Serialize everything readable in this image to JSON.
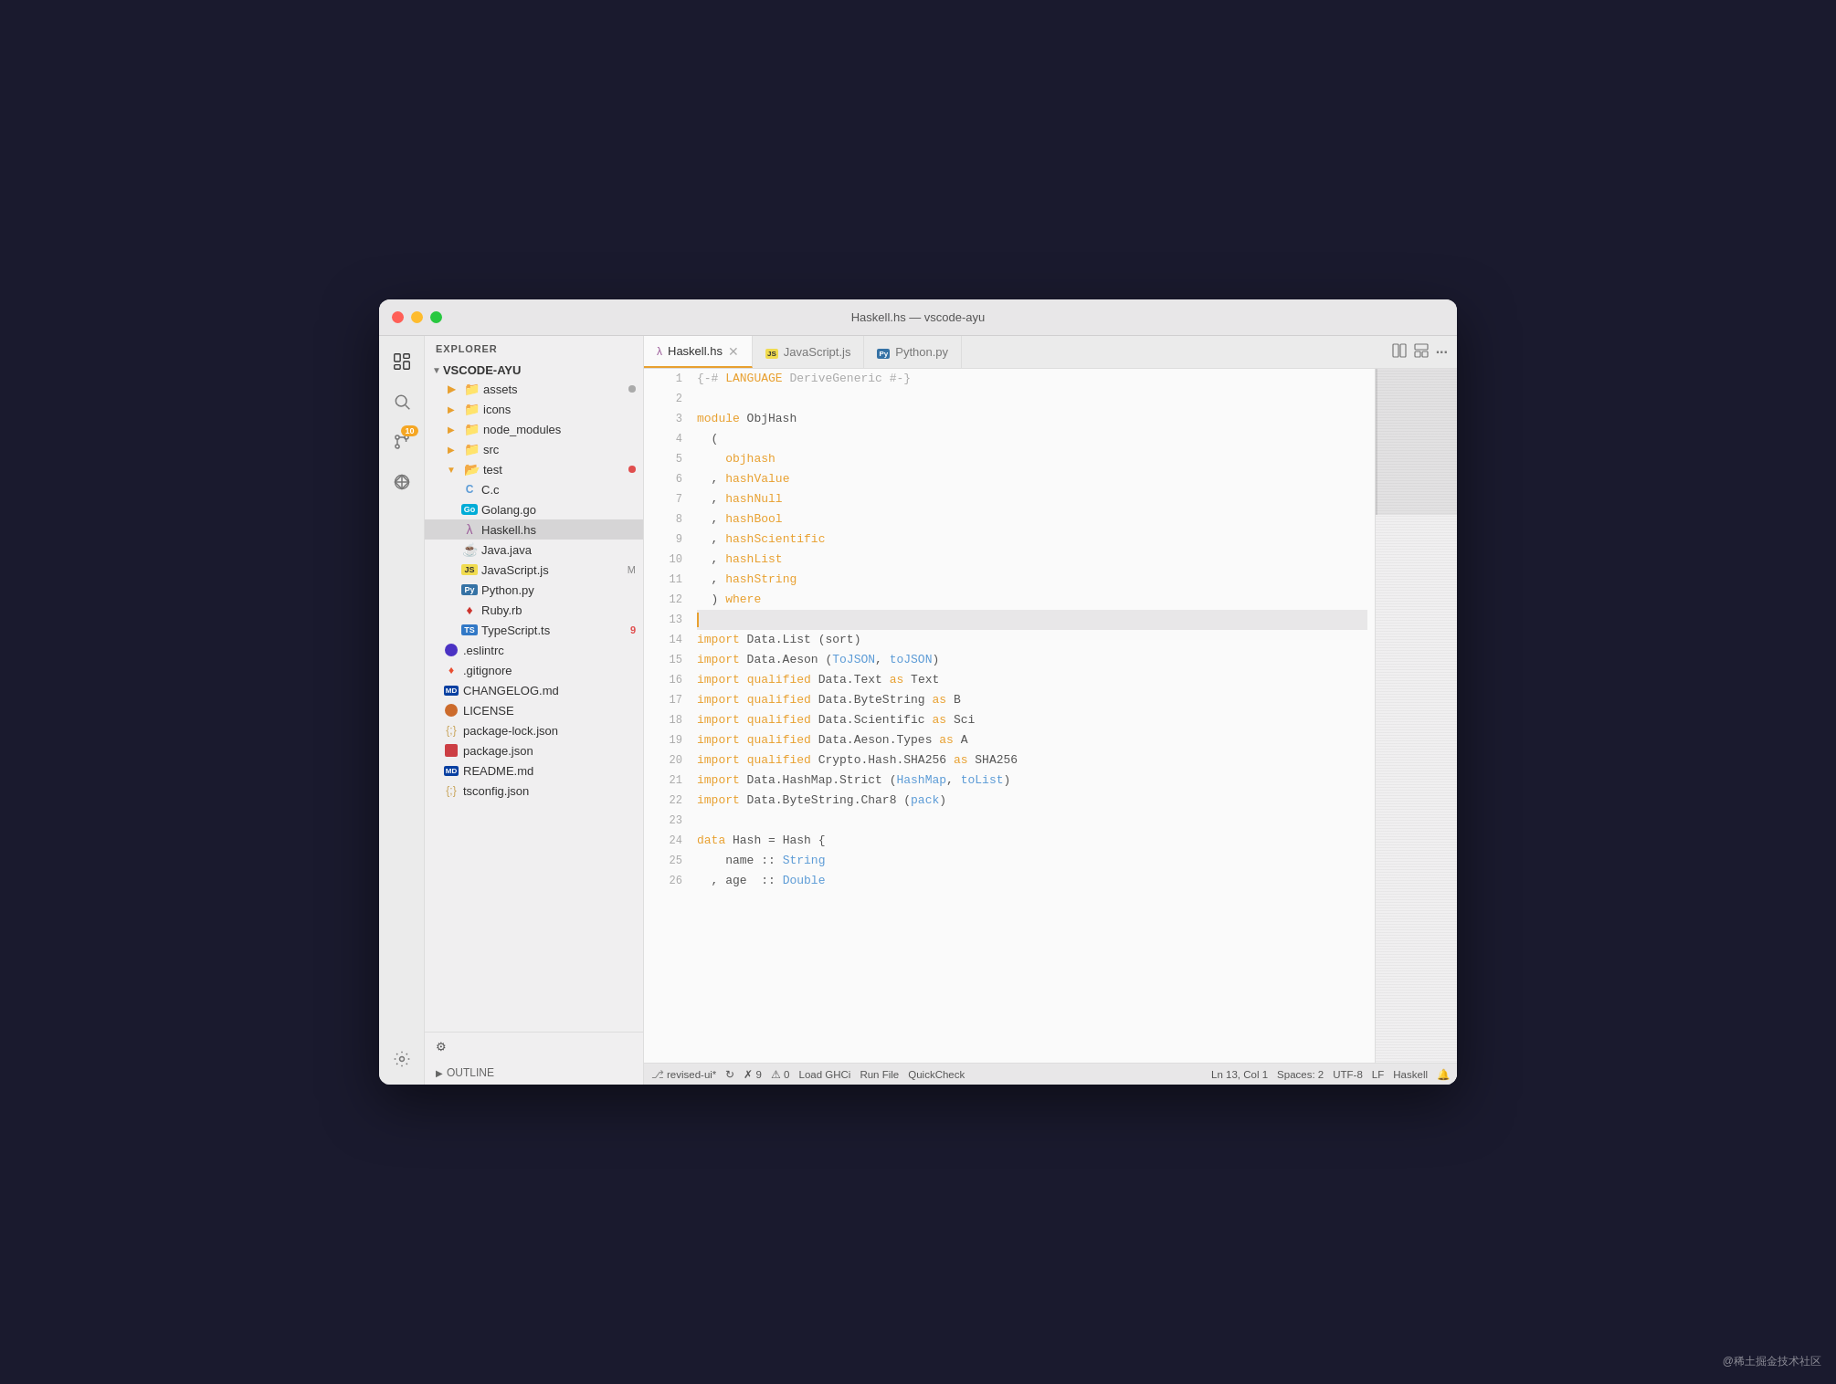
{
  "window": {
    "title": "Haskell.hs — vscode-ayu"
  },
  "tabs": [
    {
      "id": "haskell",
      "label": "Haskell.hs",
      "icon": "hs-icon",
      "active": true,
      "closable": true
    },
    {
      "id": "javascript",
      "label": "JavaScript.js",
      "icon": "js-tab-icon",
      "active": false,
      "closable": false
    },
    {
      "id": "python",
      "label": "Python.py",
      "icon": "py-tab-icon",
      "active": false,
      "closable": false
    }
  ],
  "sidebar": {
    "header": "EXPLORER",
    "root": "VSCODE-AYU",
    "items": [
      {
        "name": "assets",
        "type": "folder",
        "depth": 1,
        "badge": "dot-gray"
      },
      {
        "name": "icons",
        "type": "folder",
        "depth": 1
      },
      {
        "name": "node_modules",
        "type": "folder",
        "depth": 1
      },
      {
        "name": "src",
        "type": "folder",
        "depth": 1
      },
      {
        "name": "test",
        "type": "folder",
        "depth": 1,
        "badge": "dot-red"
      },
      {
        "name": "C.c",
        "type": "file-c",
        "depth": 2
      },
      {
        "name": "Golang.go",
        "type": "file-go",
        "depth": 2
      },
      {
        "name": "Haskell.hs",
        "type": "file-hs",
        "depth": 2,
        "active": true
      },
      {
        "name": "Java.java",
        "type": "file-java",
        "depth": 2
      },
      {
        "name": "JavaScript.js",
        "type": "file-js",
        "depth": 2,
        "badge": "M"
      },
      {
        "name": "Python.py",
        "type": "file-py",
        "depth": 2
      },
      {
        "name": "Ruby.rb",
        "type": "file-rb",
        "depth": 2
      },
      {
        "name": "TypeScript.ts",
        "type": "file-ts",
        "depth": 2,
        "badge": "9"
      },
      {
        "name": ".eslintrc",
        "type": "file-eslint",
        "depth": 1
      },
      {
        "name": ".gitignore",
        "type": "file-git",
        "depth": 1
      },
      {
        "name": "CHANGELOG.md",
        "type": "file-md",
        "depth": 1
      },
      {
        "name": "LICENSE",
        "type": "file-license",
        "depth": 1
      },
      {
        "name": "package-lock.json",
        "type": "file-json",
        "depth": 1
      },
      {
        "name": "package.json",
        "type": "file-pkg",
        "depth": 1
      },
      {
        "name": "README.md",
        "type": "file-md",
        "depth": 1
      },
      {
        "name": "tsconfig.json",
        "type": "file-json",
        "depth": 1
      }
    ],
    "outline": "OUTLINE"
  },
  "editor": {
    "lines": [
      {
        "num": 1,
        "tokens": [
          {
            "t": "{-# ",
            "c": "pragma"
          },
          {
            "t": "LANGUAGE",
            "c": "pragma-kw"
          },
          {
            "t": " DeriveGeneric #-}",
            "c": "pragma"
          }
        ]
      },
      {
        "num": 2,
        "tokens": []
      },
      {
        "num": 3,
        "tokens": [
          {
            "t": "module",
            "c": "kw"
          },
          {
            "t": " ObjHash",
            "c": "plain"
          }
        ]
      },
      {
        "num": 4,
        "tokens": [
          {
            "t": "  (",
            "c": "plain"
          }
        ]
      },
      {
        "num": 5,
        "tokens": [
          {
            "t": "    objhash",
            "c": "name-id"
          }
        ]
      },
      {
        "num": 6,
        "tokens": [
          {
            "t": "  , hashValue",
            "c": "name-id"
          }
        ]
      },
      {
        "num": 7,
        "tokens": [
          {
            "t": "  , hashNull",
            "c": "name-id"
          }
        ]
      },
      {
        "num": 8,
        "tokens": [
          {
            "t": "  , hashBool",
            "c": "name-id"
          }
        ]
      },
      {
        "num": 9,
        "tokens": [
          {
            "t": "  , hashScientific",
            "c": "name-id"
          }
        ]
      },
      {
        "num": 10,
        "tokens": [
          {
            "t": "  , hashList",
            "c": "name-id"
          }
        ]
      },
      {
        "num": 11,
        "tokens": [
          {
            "t": "  , hashString",
            "c": "name-id"
          }
        ]
      },
      {
        "num": 12,
        "tokens": [
          {
            "t": "  ) ",
            "c": "plain"
          },
          {
            "t": "where",
            "c": "kw"
          }
        ]
      },
      {
        "num": 13,
        "tokens": [],
        "highlighted": true
      },
      {
        "num": 14,
        "tokens": [
          {
            "t": "import",
            "c": "import-kw"
          },
          {
            "t": " Data.List (sort)",
            "c": "plain"
          }
        ]
      },
      {
        "num": 15,
        "tokens": [
          {
            "t": "import",
            "c": "import-kw"
          },
          {
            "t": " Data.Aeson (",
            "c": "plain"
          },
          {
            "t": "ToJSON",
            "c": "highlighted-names"
          },
          {
            "t": ", ",
            "c": "plain"
          },
          {
            "t": "toJSON",
            "c": "highlighted-names"
          },
          {
            "t": ")",
            "c": "plain"
          }
        ]
      },
      {
        "num": 16,
        "tokens": [
          {
            "t": "import",
            "c": "import-kw"
          },
          {
            "t": " ",
            "c": "plain"
          },
          {
            "t": "qualified",
            "c": "qualified-kw"
          },
          {
            "t": " Data.Text ",
            "c": "plain"
          },
          {
            "t": "as",
            "c": "as-kw"
          },
          {
            "t": " Text",
            "c": "plain"
          }
        ]
      },
      {
        "num": 17,
        "tokens": [
          {
            "t": "import",
            "c": "import-kw"
          },
          {
            "t": " ",
            "c": "plain"
          },
          {
            "t": "qualified",
            "c": "qualified-kw"
          },
          {
            "t": " Data.ByteString ",
            "c": "plain"
          },
          {
            "t": "as",
            "c": "as-kw"
          },
          {
            "t": " B",
            "c": "plain"
          }
        ]
      },
      {
        "num": 18,
        "tokens": [
          {
            "t": "import",
            "c": "import-kw"
          },
          {
            "t": " ",
            "c": "plain"
          },
          {
            "t": "qualified",
            "c": "qualified-kw"
          },
          {
            "t": " Data.Scientific ",
            "c": "plain"
          },
          {
            "t": "as",
            "c": "as-kw"
          },
          {
            "t": " Sci",
            "c": "plain"
          }
        ]
      },
      {
        "num": 19,
        "tokens": [
          {
            "t": "import",
            "c": "import-kw"
          },
          {
            "t": " ",
            "c": "plain"
          },
          {
            "t": "qualified",
            "c": "qualified-kw"
          },
          {
            "t": " Data.Aeson.Types ",
            "c": "plain"
          },
          {
            "t": "as",
            "c": "as-kw"
          },
          {
            "t": " A",
            "c": "plain"
          }
        ]
      },
      {
        "num": 20,
        "tokens": [
          {
            "t": "import",
            "c": "import-kw"
          },
          {
            "t": " ",
            "c": "plain"
          },
          {
            "t": "qualified",
            "c": "qualified-kw"
          },
          {
            "t": " Crypto.Hash.SHA256 ",
            "c": "plain"
          },
          {
            "t": "as",
            "c": "as-kw"
          },
          {
            "t": " SHA256",
            "c": "plain"
          }
        ]
      },
      {
        "num": 21,
        "tokens": [
          {
            "t": "import",
            "c": "import-kw"
          },
          {
            "t": " Data.HashMap.Strict (",
            "c": "plain"
          },
          {
            "t": "HashMap",
            "c": "highlighted-names"
          },
          {
            "t": ", ",
            "c": "plain"
          },
          {
            "t": "toList",
            "c": "highlighted-names"
          },
          {
            "t": ")",
            "c": "plain"
          }
        ]
      },
      {
        "num": 22,
        "tokens": [
          {
            "t": "import",
            "c": "import-kw"
          },
          {
            "t": " Data.ByteString.Char8 (",
            "c": "plain"
          },
          {
            "t": "pack",
            "c": "highlighted-names"
          },
          {
            "t": ")",
            "c": "plain"
          }
        ]
      },
      {
        "num": 23,
        "tokens": []
      },
      {
        "num": 24,
        "tokens": [
          {
            "t": "data",
            "c": "data-kw"
          },
          {
            "t": " Hash = Hash {",
            "c": "plain"
          }
        ]
      },
      {
        "num": 25,
        "tokens": [
          {
            "t": "    name :: ",
            "c": "plain"
          },
          {
            "t": "String",
            "c": "type"
          }
        ]
      },
      {
        "num": 26,
        "tokens": [
          {
            "t": "  , age  :: ",
            "c": "plain"
          },
          {
            "t": "Double",
            "c": "type"
          }
        ]
      }
    ]
  },
  "status_bar": {
    "git_branch": "revised-ui*",
    "sync_icon": "↻",
    "errors": "✗ 9",
    "warnings": "⚠ 0",
    "load_ghci": "Load GHCi",
    "run_file": "Run File",
    "quickcheck": "QuickCheck",
    "position": "Ln 13, Col 1",
    "spaces": "Spaces: 2",
    "encoding": "UTF-8",
    "line_ending": "LF",
    "language": "Haskell",
    "bell": "🔔"
  },
  "watermark": "@稀土掘金技术社区"
}
